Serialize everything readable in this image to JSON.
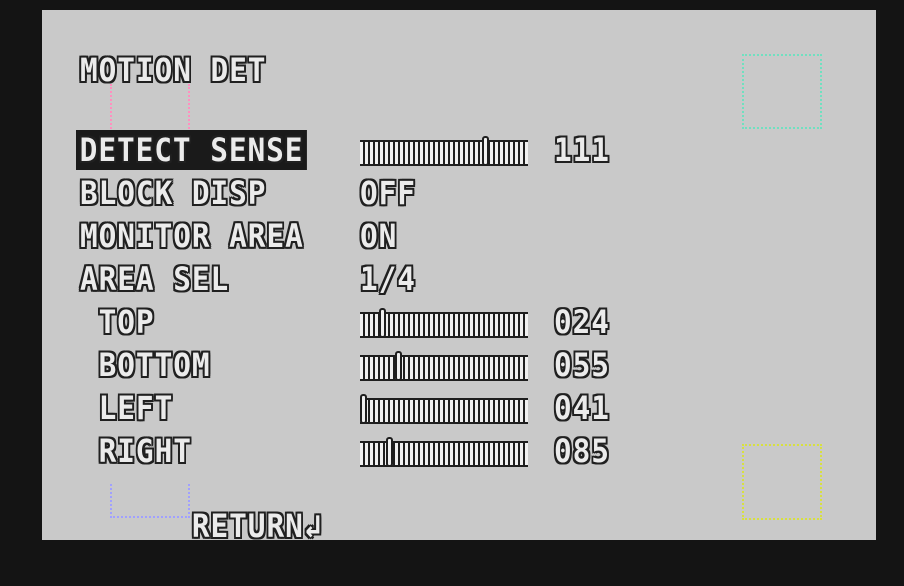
{
  "menu": {
    "title": "MOTION DET",
    "items": [
      {
        "label": "DETECT SENSE",
        "value": "111",
        "slider": 0.76,
        "selected": true
      },
      {
        "label": "BLOCK DISP",
        "value": "OFF"
      },
      {
        "label": "MONITOR AREA",
        "value": "ON"
      },
      {
        "label": "AREA SEL",
        "value": "1/4"
      },
      {
        "label": " TOP",
        "value": "024",
        "slider": 0.12
      },
      {
        "label": " BOTTOM",
        "value": "055",
        "slider": 0.22
      },
      {
        "label": " LEFT",
        "value": "041",
        "slider": 0.0
      },
      {
        "label": " RIGHT",
        "value": "085",
        "slider": 0.16
      }
    ],
    "return_label": "RETURN",
    "return_icon": "enter-icon"
  },
  "colors": {
    "area_box_1": "#ff8fbf",
    "area_box_2": "#70e0c0",
    "area_box_3": "#a0a0ff",
    "area_box_4": "#d8e040"
  }
}
